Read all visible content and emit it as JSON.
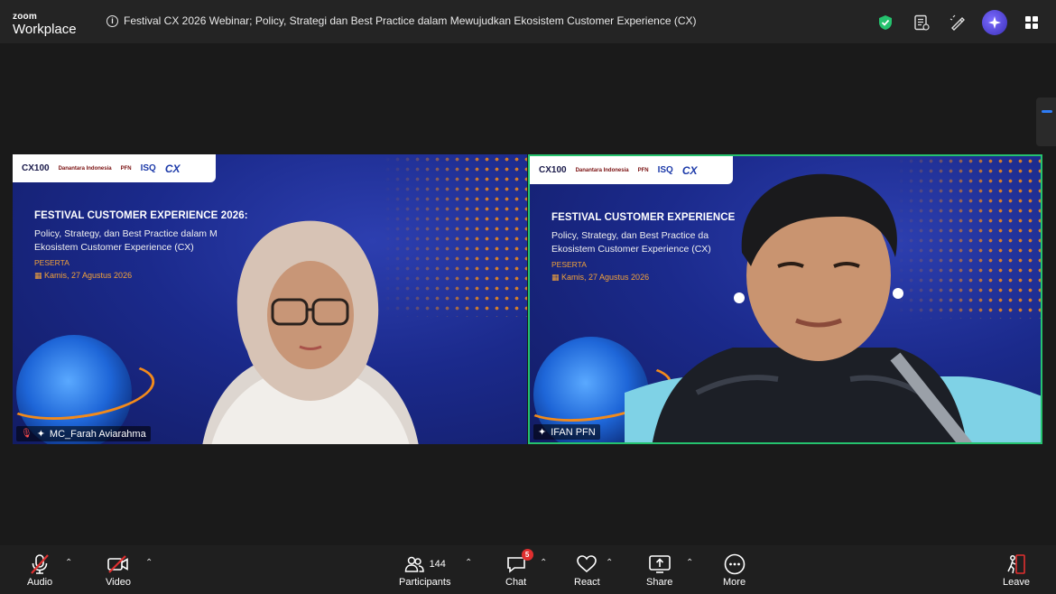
{
  "app": {
    "brand_top": "zoom",
    "brand_bottom": "Workplace"
  },
  "meeting": {
    "title": "Festival CX 2026 Webinar; Policy, Strategi dan Best Practice dalam Mewujudkan Ekosistem Customer Experience (CX)"
  },
  "titlebar_icons": [
    "shield-check-icon",
    "notes-icon",
    "whiteboard-pen-icon",
    "ai-companion-icon",
    "apps-grid-icon"
  ],
  "tiles": [
    {
      "name": "MC_Farah Aviarahma",
      "slide": {
        "title": "FESTIVAL CUSTOMER EXPERIENCE 2026:",
        "subtitle_line1": "Policy, Strategy, dan Best Practice dalam M",
        "subtitle_line2": "Ekosistem Customer Experience (CX)",
        "role": "PESERTA",
        "date": "Kamis, 27 Agustus 2026"
      },
      "muted": true
    },
    {
      "name": "IFAN PFN",
      "slide": {
        "title": "FESTIVAL CUSTOMER EXPERIENCE",
        "subtitle_line1": "Policy, Strategy, dan Best Practice da",
        "subtitle_line2": "Ekosistem Customer Experience (CX)",
        "role": "PESERTA",
        "date": "Kamis, 27 Agustus 2026"
      },
      "muted": false,
      "active_speaker": true
    }
  ],
  "logos": {
    "cx100": "CX100",
    "danantara": "Danantara Indonesia",
    "pfn": "PFN",
    "isq": "ISQ",
    "cx": "CX"
  },
  "toolbar": {
    "audio": "Audio",
    "video": "Video",
    "participants": "Participants",
    "participants_count": "144",
    "chat": "Chat",
    "chat_badge": "5",
    "react": "React",
    "share": "Share",
    "more": "More",
    "leave": "Leave"
  },
  "colors": {
    "active_border": "#25c26e",
    "accent_blue": "#2e7cf6",
    "slide_bg": "#1b2a8c",
    "slide_orange": "#f28a1b"
  }
}
